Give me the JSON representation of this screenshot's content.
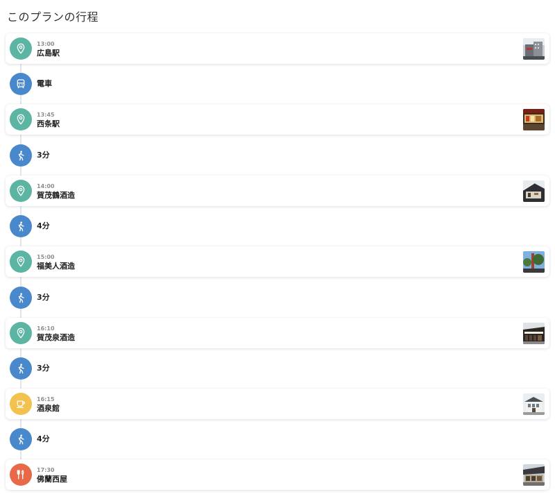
{
  "title": "このプランの行程",
  "colors": {
    "spot": "#5bb5a2",
    "transit": "#4a88cc",
    "cafe": "#f2c14e",
    "restaurant": "#e8694a"
  },
  "itinerary": [
    {
      "kind": "spot",
      "icon": "map-pin-icon",
      "time": "13:00",
      "name": "広島駅",
      "has_photo": true
    },
    {
      "kind": "transit",
      "icon": "train-icon",
      "label": "電車"
    },
    {
      "kind": "spot",
      "icon": "map-pin-icon",
      "time": "13:45",
      "name": "西条駅",
      "has_photo": true
    },
    {
      "kind": "transit",
      "icon": "walk-icon",
      "label": "3分"
    },
    {
      "kind": "spot",
      "icon": "map-pin-icon",
      "time": "14:00",
      "name": "賀茂鶴酒造",
      "has_photo": true
    },
    {
      "kind": "transit",
      "icon": "walk-icon",
      "label": "4分"
    },
    {
      "kind": "spot",
      "icon": "map-pin-icon",
      "time": "15:00",
      "name": "福美人酒造",
      "has_photo": true
    },
    {
      "kind": "transit",
      "icon": "walk-icon",
      "label": "3分"
    },
    {
      "kind": "spot",
      "icon": "map-pin-icon",
      "time": "16:10",
      "name": "賀茂泉酒造",
      "has_photo": true
    },
    {
      "kind": "transit",
      "icon": "walk-icon",
      "label": "3分"
    },
    {
      "kind": "cafe",
      "icon": "coffee-cup-icon",
      "time": "16:15",
      "name": "酒泉館",
      "has_photo": true
    },
    {
      "kind": "transit",
      "icon": "walk-icon",
      "label": "4分"
    },
    {
      "kind": "restaurant",
      "icon": "fork-knife-icon",
      "time": "17:30",
      "name": "佛蘭西屋",
      "has_photo": true
    }
  ]
}
